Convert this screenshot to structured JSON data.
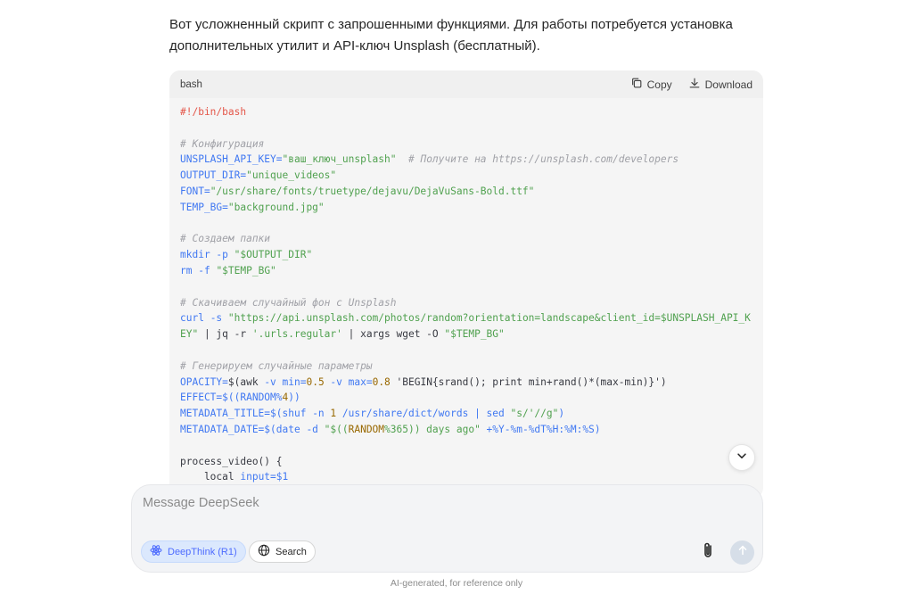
{
  "message": {
    "intro_line1": "Вот усложненный скрипт с запрошенными функциями. Для работы потребуется установка",
    "intro_line2": "дополнительных утилит и API-ключ Unsplash (бесплатный)."
  },
  "code_block": {
    "language": "bash",
    "copy_label": "Copy",
    "download_label": "Download",
    "lines": [
      [
        {
          "t": "#!/bin/bash",
          "c": "shebang"
        }
      ],
      [],
      [
        {
          "t": "# Конфигурация",
          "c": "comment"
        }
      ],
      [
        {
          "t": "UNSPLASH_API_KEY=",
          "c": "var"
        },
        {
          "t": "\"ваш_ключ_unsplash\"",
          "c": "str"
        },
        {
          "t": "  ",
          "c": "plain"
        },
        {
          "t": "# Получите на https://unsplash.com/developers",
          "c": "comment"
        }
      ],
      [
        {
          "t": "OUTPUT_DIR=",
          "c": "var"
        },
        {
          "t": "\"unique_videos\"",
          "c": "str"
        }
      ],
      [
        {
          "t": "FONT=",
          "c": "var"
        },
        {
          "t": "\"/usr/share/fonts/truetype/dejavu/DejaVuSans-Bold.ttf\"",
          "c": "str"
        }
      ],
      [
        {
          "t": "TEMP_BG=",
          "c": "var"
        },
        {
          "t": "\"background.jpg\"",
          "c": "str"
        }
      ],
      [],
      [
        {
          "t": "# Создаем папки",
          "c": "comment"
        }
      ],
      [
        {
          "t": "mkdir",
          "c": "kw"
        },
        {
          "t": " -p ",
          "c": "var"
        },
        {
          "t": "\"$OUTPUT_DIR\"",
          "c": "str"
        }
      ],
      [
        {
          "t": "rm",
          "c": "kw"
        },
        {
          "t": " -f ",
          "c": "var"
        },
        {
          "t": "\"$TEMP_BG\"",
          "c": "str"
        }
      ],
      [],
      [
        {
          "t": "# Скачиваем случайный фон с Unsplash",
          "c": "comment"
        }
      ],
      [
        {
          "t": "curl",
          "c": "kw"
        },
        {
          "t": " -s ",
          "c": "var"
        },
        {
          "t": "\"https://api.unsplash.com/photos/random?orientation=landscape&client_id=$UNSPLASH_API_K",
          "c": "str"
        }
      ],
      [
        {
          "t": "EY\"",
          "c": "str"
        },
        {
          "t": " | jq -r ",
          "c": "plain"
        },
        {
          "t": "'.urls.regular'",
          "c": "str"
        },
        {
          "t": " | xargs wget -O ",
          "c": "plain"
        },
        {
          "t": "\"$TEMP_BG\"",
          "c": "str"
        }
      ],
      [],
      [
        {
          "t": "# Генерируем случайные параметры",
          "c": "comment"
        }
      ],
      [
        {
          "t": "OPACITY=",
          "c": "var"
        },
        {
          "t": "$(awk ",
          "c": "plain"
        },
        {
          "t": "-v min=",
          "c": "var"
        },
        {
          "t": "0.5",
          "c": "num"
        },
        {
          "t": " -v max=",
          "c": "var"
        },
        {
          "t": "0.8",
          "c": "num"
        },
        {
          "t": " 'BEGIN{srand(); print min+rand()*(max-min)}')",
          "c": "plain"
        }
      ],
      [
        {
          "t": "EFFECT=",
          "c": "var"
        },
        {
          "t": "$((RANDOM%",
          "c": "var"
        },
        {
          "t": "4",
          "c": "num"
        },
        {
          "t": "))",
          "c": "var"
        }
      ],
      [
        {
          "t": "METADATA_TITLE=",
          "c": "var"
        },
        {
          "t": "$(shuf -n ",
          "c": "var"
        },
        {
          "t": "1",
          "c": "num"
        },
        {
          "t": " /usr/share/dict/words | sed ",
          "c": "var"
        },
        {
          "t": "\"s/'//g\"",
          "c": "str"
        },
        {
          "t": ")",
          "c": "var"
        }
      ],
      [
        {
          "t": "METADATA_DATE=",
          "c": "var"
        },
        {
          "t": "$(date -d ",
          "c": "var"
        },
        {
          "t": "\"$((",
          "c": "str"
        },
        {
          "t": "RANDOM",
          "c": "num"
        },
        {
          "t": "%365)) days ago\"",
          "c": "str"
        },
        {
          "t": " +%Y-%m-%dT%H:%M:%S)",
          "c": "var"
        }
      ],
      [],
      [
        {
          "t": "process_video() {",
          "c": "plain"
        }
      ],
      [
        {
          "t": "    local ",
          "c": "plain"
        },
        {
          "t": "input=$1",
          "c": "var"
        }
      ]
    ]
  },
  "composer": {
    "placeholder": "Message DeepSeek",
    "deepthink_label": "DeepThink (R1)",
    "search_label": "Search"
  },
  "footer": {
    "disclaimer": "AI-generated, for reference only"
  },
  "icons": {
    "copy": "copy-icon",
    "download": "download-icon",
    "scroll_down": "chevron-down-icon",
    "deepthink": "atom-icon",
    "search": "globe-icon",
    "attach": "paperclip-icon",
    "send": "arrow-up-icon"
  },
  "colors": {
    "accent": "#4d6bfe",
    "code_background": "#f5f5f5",
    "composer_background": "#f3f4f6"
  }
}
